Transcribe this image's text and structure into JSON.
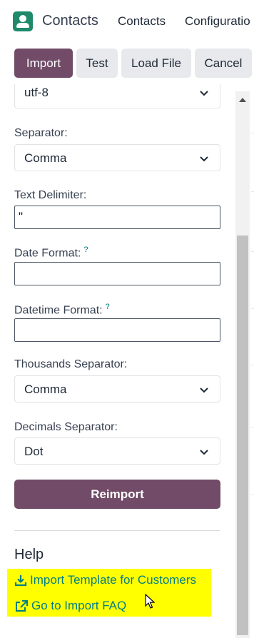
{
  "navbar": {
    "app_title": "Contacts",
    "menu": [
      "Contacts",
      "Configuratio"
    ]
  },
  "actions": {
    "import": "Import",
    "test": "Test",
    "load_file": "Load File",
    "cancel": "Cancel"
  },
  "options": {
    "encoding_value": "utf-8",
    "separator_label": "Separator:",
    "separator_value": "Comma",
    "text_delimiter_label": "Text Delimiter:",
    "text_delimiter_value": "\"",
    "date_format_label": "Date Format:",
    "date_format_value": "",
    "datetime_format_label": "Datetime Format:",
    "datetime_format_value": "",
    "help_marker": "?",
    "thousands_label": "Thousands Separator:",
    "thousands_value": "Comma",
    "decimals_label": "Decimals Separator:",
    "decimals_value": "Dot",
    "reimport": "Reimport"
  },
  "help": {
    "title": "Help",
    "template_link": "Import Template for Customers",
    "faq_link": "Go to Import FAQ"
  },
  "colors": {
    "primary": "#714b67",
    "link": "#017e84",
    "highlight": "#ffff00"
  }
}
